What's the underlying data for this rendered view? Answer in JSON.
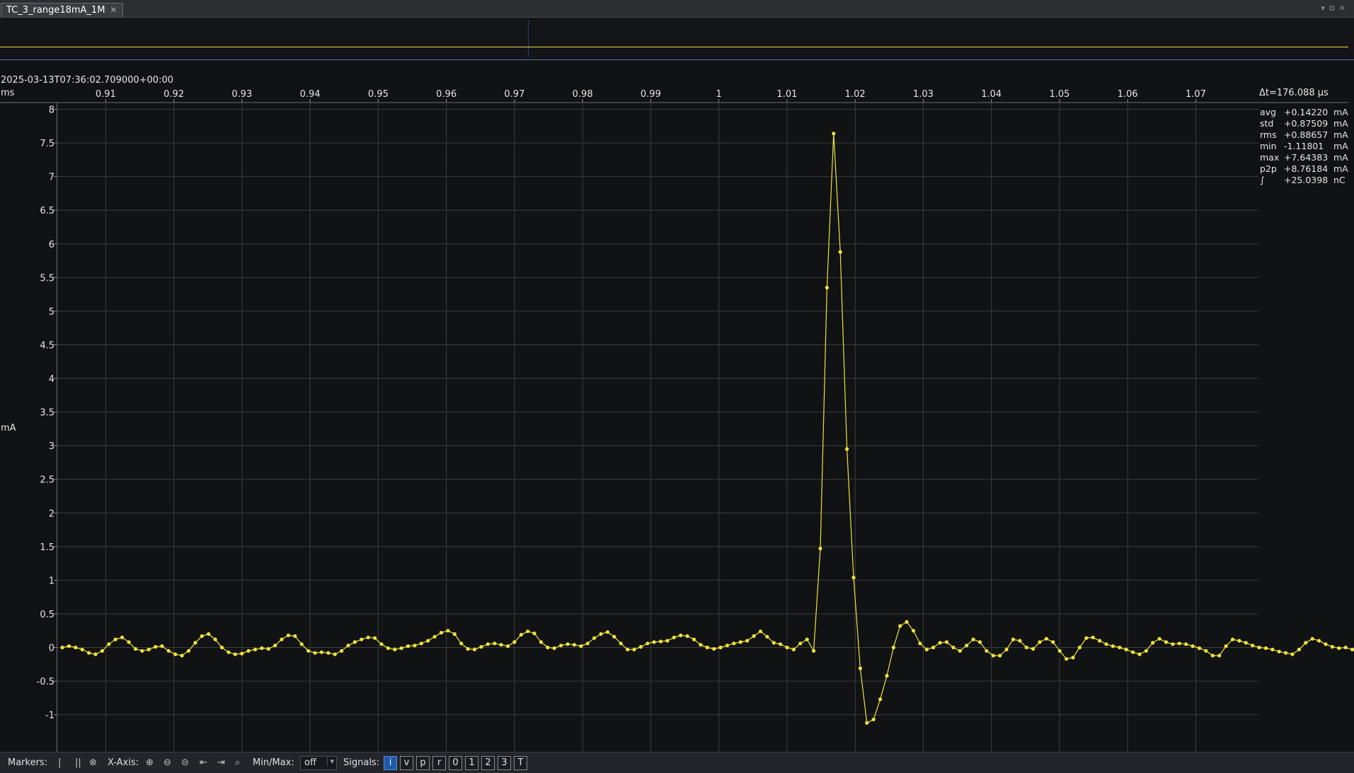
{
  "tab": {
    "title": "TC_3_range18mA_1M"
  },
  "timestamp": "2025-03-13T07:36:02.709000+00:00",
  "x_unit": "ms",
  "delta_t": "Δt=176.088 µs",
  "y_unit": "mA",
  "stats": [
    {
      "label": "avg",
      "value": "+0.14220",
      "unit": "mA"
    },
    {
      "label": "std",
      "value": "+0.87509",
      "unit": "mA"
    },
    {
      "label": "rms",
      "value": "+0.88657",
      "unit": "mA"
    },
    {
      "label": "min",
      "value": "-1.11801",
      "unit": "mA"
    },
    {
      "label": "max",
      "value": "+7.64383",
      "unit": "mA"
    },
    {
      "label": "p2p",
      "value": "+8.76184",
      "unit": "mA"
    },
    {
      "label": "∫",
      "value": "+25.0398",
      "unit": "nC"
    }
  ],
  "toolbar": {
    "markers_label": "Markers:",
    "xaxis_label": "X-Axis:",
    "minmax_label": "Min/Max:",
    "minmax_value": "off",
    "signals_label": "Signals:",
    "signals": [
      "i",
      "v",
      "p",
      "r",
      "0",
      "1",
      "2",
      "3",
      "T"
    ]
  },
  "colors": {
    "signal": "#f0e43a",
    "grid": "#3a3c40",
    "background": "#111213",
    "active_signal": "#1e5aa8"
  },
  "chart_data": {
    "type": "line",
    "xlabel": "ms",
    "ylabel": "mA",
    "xlim": [
      0.9029,
      1.0792
    ],
    "ylim": [
      -1.55,
      8.1
    ],
    "x_ticks": [
      "0.91",
      "0.92",
      "0.93",
      "0.94",
      "0.95",
      "0.96",
      "0.97",
      "0.98",
      "0.99",
      "1",
      "1.01",
      "1.02",
      "1.03",
      "1.04",
      "1.05",
      "1.06",
      "1.07"
    ],
    "y_ticks": [
      "8",
      "7.5",
      "7",
      "6.5",
      "6",
      "5.5",
      "5",
      "4.5",
      "4",
      "3.5",
      "3",
      "2.5",
      "2",
      "1.5",
      "1",
      "0.5",
      "0",
      "-0.5",
      "-1"
    ],
    "grid": true,
    "series": [
      {
        "x0": 0.90363,
        "dx": 0.000976,
        "values": [
          0.0,
          0.02,
          0.0,
          -0.03,
          -0.08,
          -0.1,
          -0.05,
          0.05,
          0.12,
          0.15,
          0.08,
          -0.02,
          -0.05,
          -0.03,
          0.01,
          0.02,
          -0.05,
          -0.1,
          -0.12,
          -0.05,
          0.07,
          0.17,
          0.2,
          0.12,
          0.0,
          -0.07,
          -0.1,
          -0.09,
          -0.05,
          -0.03,
          -0.01,
          -0.02,
          0.03,
          0.12,
          0.18,
          0.17,
          0.05,
          -0.05,
          -0.08,
          -0.07,
          -0.08,
          -0.1,
          -0.05,
          0.03,
          0.08,
          0.12,
          0.15,
          0.14,
          0.05,
          -0.01,
          -0.03,
          -0.01,
          0.02,
          0.03,
          0.06,
          0.1,
          0.16,
          0.22,
          0.25,
          0.2,
          0.06,
          -0.02,
          -0.03,
          0.01,
          0.05,
          0.06,
          0.04,
          0.02,
          0.08,
          0.19,
          0.24,
          0.21,
          0.08,
          0.0,
          -0.01,
          0.03,
          0.05,
          0.04,
          0.02,
          0.06,
          0.14,
          0.2,
          0.23,
          0.16,
          0.06,
          -0.03,
          -0.03,
          0.01,
          0.06,
          0.08,
          0.09,
          0.1,
          0.15,
          0.18,
          0.17,
          0.12,
          0.04,
          0.0,
          -0.02,
          0.0,
          0.03,
          0.06,
          0.08,
          0.1,
          0.17,
          0.24,
          0.16,
          0.07,
          0.05,
          0.0,
          -0.03,
          0.06,
          0.12,
          -0.05,
          1.47,
          5.35,
          7.64,
          5.88,
          2.95,
          1.04,
          -0.31,
          -1.12,
          -1.07,
          -0.77,
          -0.42,
          0.0,
          0.32,
          0.38,
          0.25,
          0.06,
          -0.03,
          0.0,
          0.07,
          0.08,
          0.0,
          -0.05,
          0.03,
          0.12,
          0.08,
          -0.05,
          -0.12,
          -0.12,
          -0.03,
          0.12,
          0.1,
          0.0,
          -0.02,
          0.08,
          0.13,
          0.08,
          -0.05,
          -0.17,
          -0.15,
          0.0,
          0.14,
          0.15,
          0.1,
          0.05,
          0.02,
          0.0,
          -0.03,
          -0.07,
          -0.1,
          -0.05,
          0.07,
          0.13,
          0.08,
          0.05,
          0.06,
          0.05,
          0.02,
          -0.01,
          -0.05,
          -0.12,
          -0.12,
          0.02,
          0.12,
          0.1,
          0.07,
          0.03,
          0.0,
          -0.01,
          -0.03,
          -0.06,
          -0.08,
          -0.1,
          -0.03,
          0.07,
          0.13,
          0.1,
          0.05,
          0.01,
          -0.01,
          0.0,
          -0.03,
          -0.07,
          -0.1,
          -0.02,
          0.08
        ]
      }
    ]
  }
}
